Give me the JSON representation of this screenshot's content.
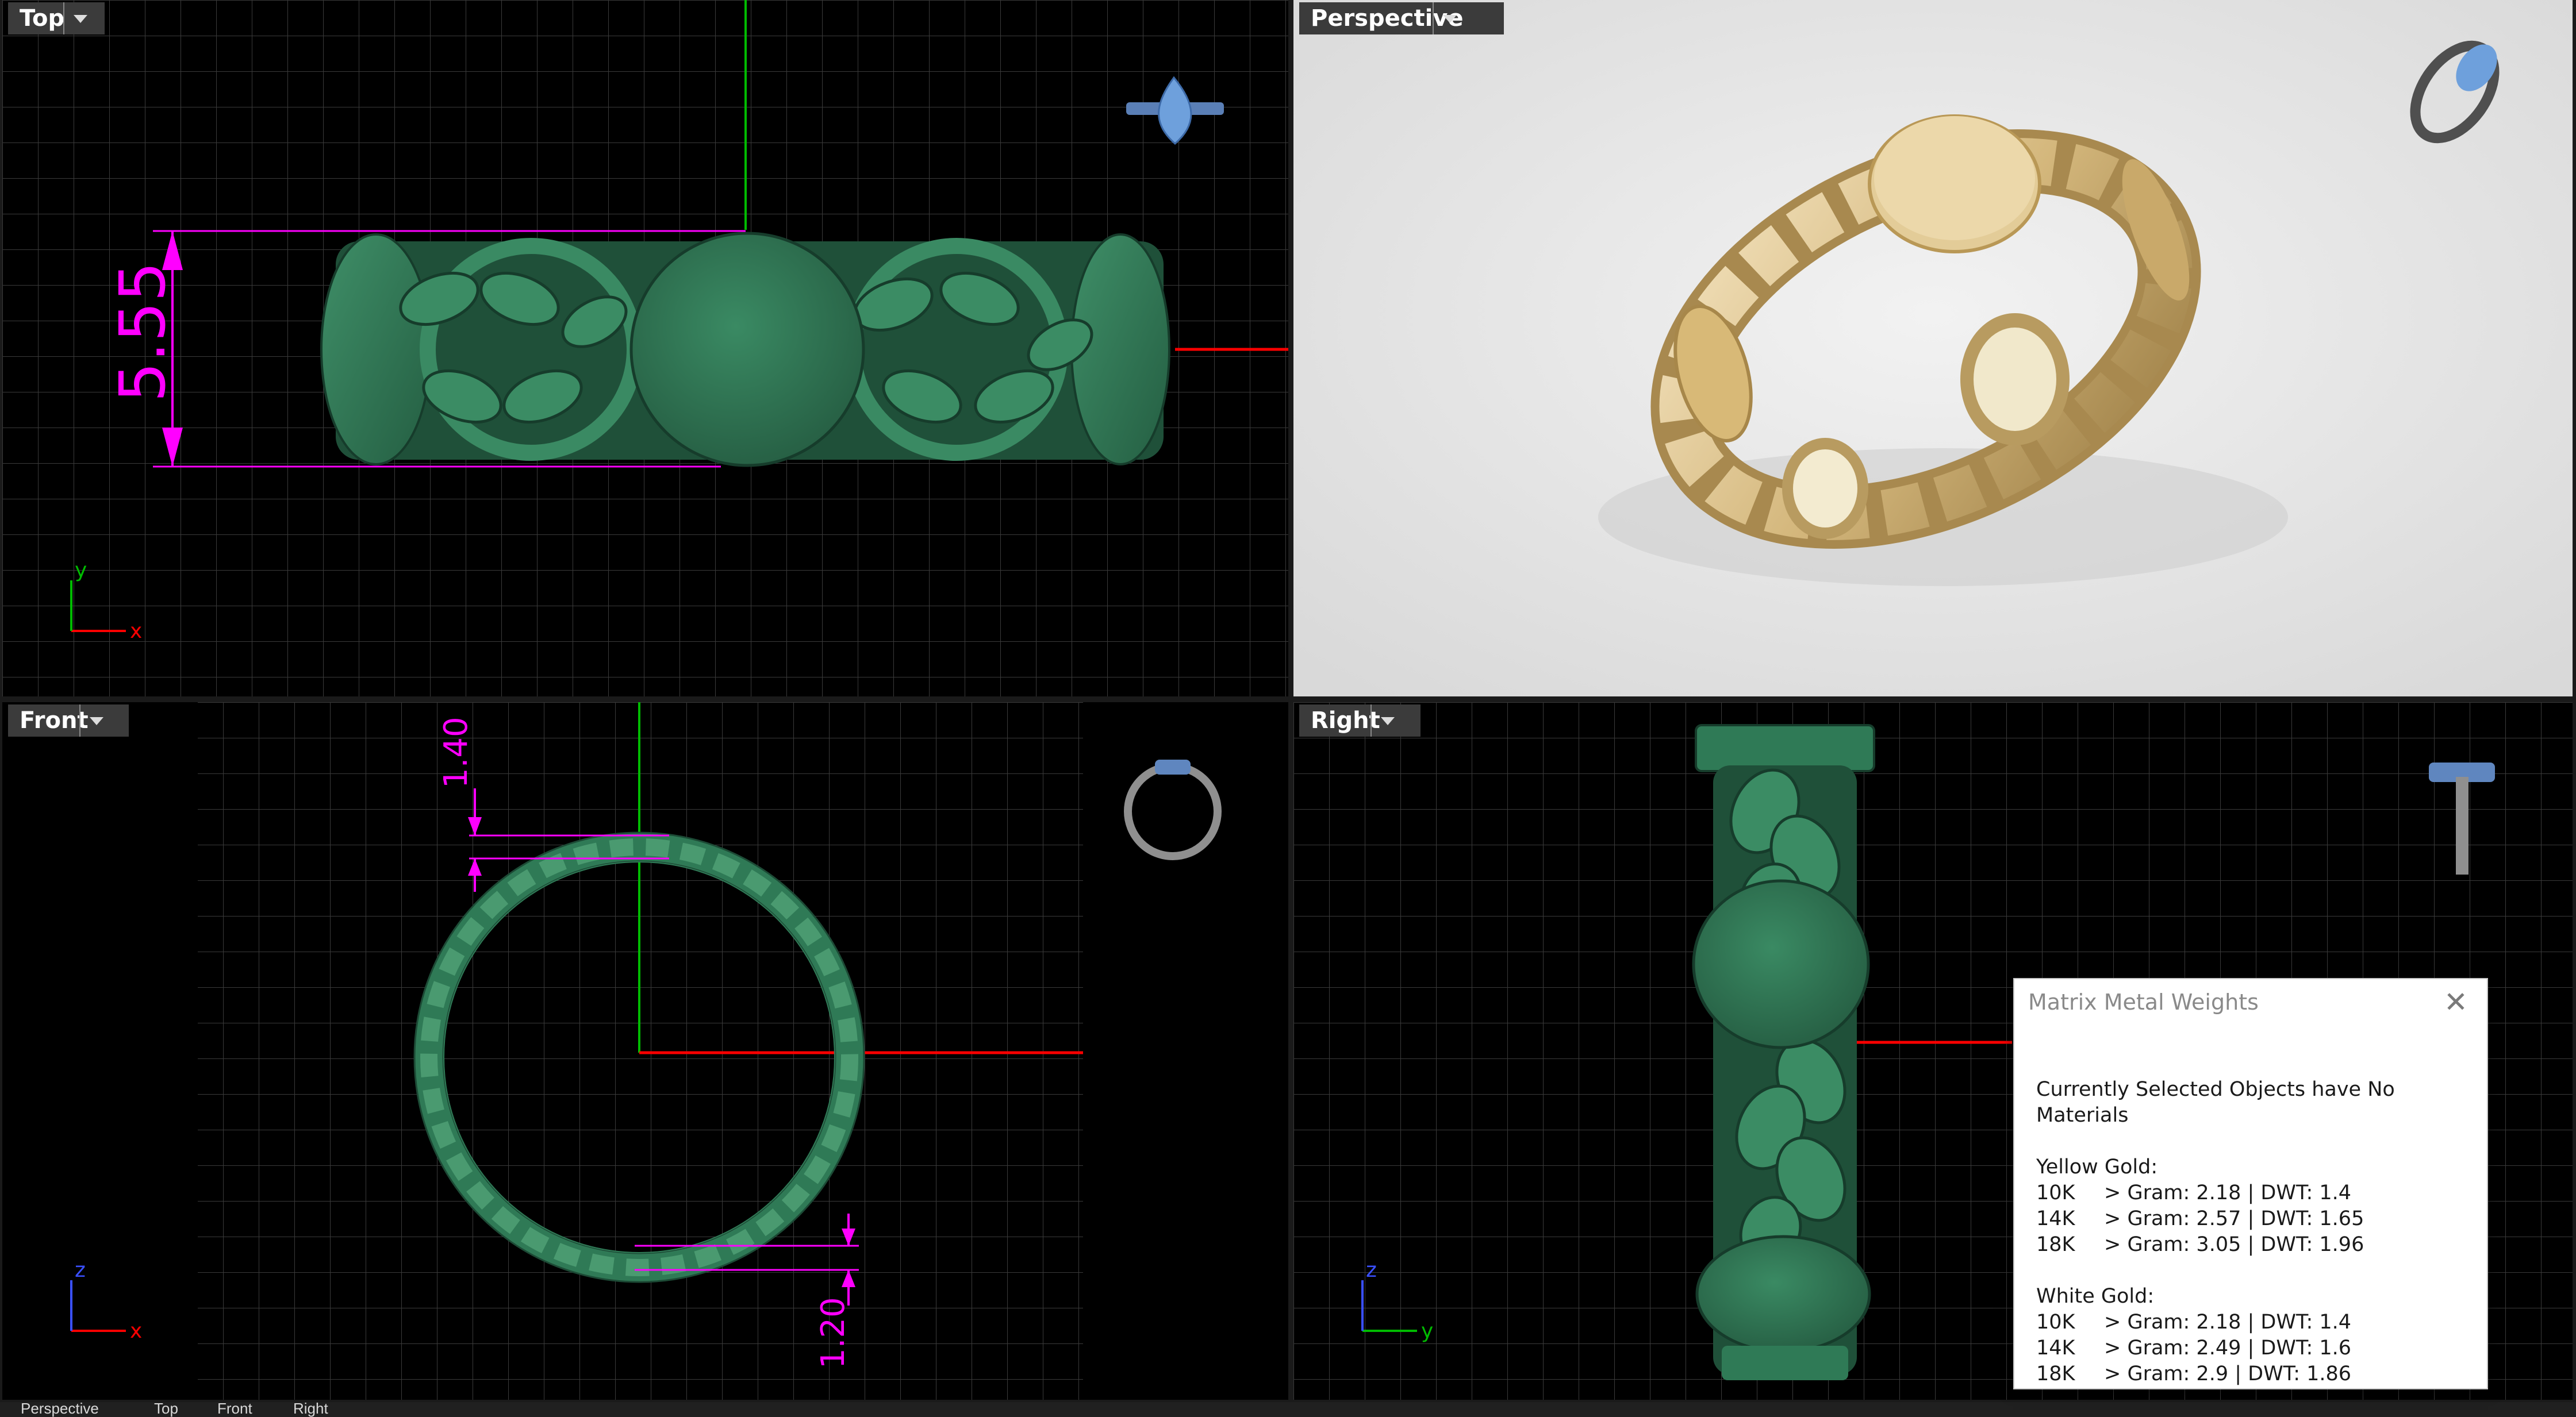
{
  "viewports": {
    "top": {
      "title": "Top"
    },
    "perspective": {
      "title": "Perspective"
    },
    "front": {
      "title": "Front"
    },
    "right": {
      "title": "Right"
    }
  },
  "dimensions": {
    "top_width": "5.55",
    "front_top": "1.40",
    "front_bottom": "1.20"
  },
  "axes": {
    "top": {
      "x": "x",
      "y": "y"
    },
    "front": {
      "x": "x",
      "y": "z"
    },
    "right": {
      "x": "y",
      "y": "z"
    }
  },
  "tabs": [
    "Perspective",
    "Top",
    "Front",
    "Right"
  ],
  "metal_weights": {
    "title": "Matrix Metal Weights",
    "close_glyph": "✕",
    "status": "Currently Selected Objects have No Materials",
    "yellow": {
      "label": "Yellow Gold:",
      "rows": [
        {
          "karat": "10K",
          "value": "> Gram: 2.18 | DWT: 1.4"
        },
        {
          "karat": "14K",
          "value": "> Gram: 2.57 | DWT: 1.65"
        },
        {
          "karat": "18K",
          "value": "> Gram: 3.05 | DWT: 1.96"
        }
      ]
    },
    "white": {
      "label": "White Gold:",
      "rows": [
        {
          "karat": "10K",
          "value": "> Gram: 2.18 | DWT: 1.4"
        },
        {
          "karat": "14K",
          "value": "> Gram: 2.49 | DWT: 1.6"
        },
        {
          "karat": "18K",
          "value": "> Gram: 2.9 | DWT: 1.86"
        }
      ]
    }
  },
  "colors": {
    "model_green": "#2f7a56",
    "dimension_magenta": "#ff00ff",
    "axis_red": "#ff0000",
    "axis_green": "#00bb00",
    "gold": "#d7bd86"
  }
}
